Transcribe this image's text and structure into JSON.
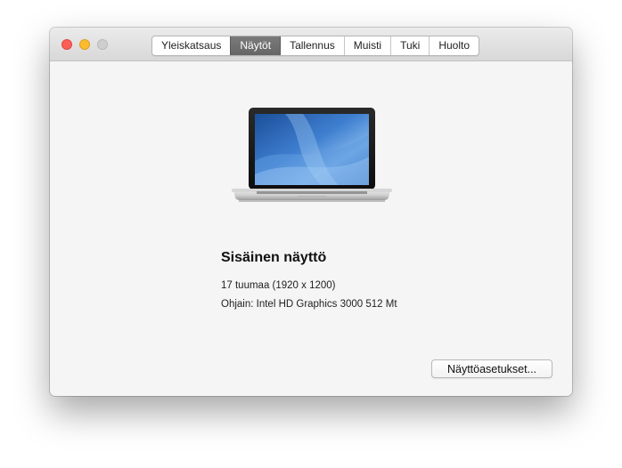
{
  "window": {
    "buttons": {
      "close": "close",
      "minimize": "minimize",
      "zoom": "zoom"
    }
  },
  "tabs": [
    {
      "label": "Yleiskatsaus",
      "selected": false
    },
    {
      "label": "Näytöt",
      "selected": true
    },
    {
      "label": "Tallennus",
      "selected": false
    },
    {
      "label": "Muisti",
      "selected": false
    },
    {
      "label": "Tuki",
      "selected": false
    },
    {
      "label": "Huolto",
      "selected": false
    }
  ],
  "display": {
    "image_icon": "laptop-icon",
    "name": "Sisäinen näyttö",
    "size": "17 tuumaa (1920 x 1200)",
    "driver": "Ohjain: Intel HD Graphics 3000 512 Mt"
  },
  "actions": {
    "settings_label": "Näyttöasetukset..."
  },
  "colors": {
    "close": "#fc5f57",
    "minimize": "#fdbb2e",
    "zoom": "#cfcfcf",
    "selected_tab": "#6e6e6e"
  }
}
